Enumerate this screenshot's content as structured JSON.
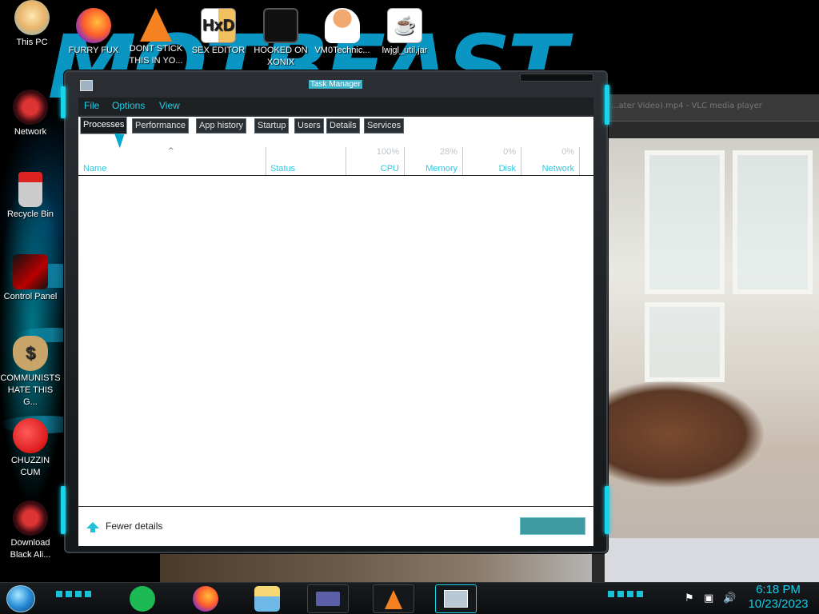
{
  "desktop": {
    "icons": [
      {
        "label": "This PC"
      },
      {
        "label": "FURRY FUX"
      },
      {
        "label": "DONT STICK\nTHIS IN YO..."
      },
      {
        "label": "SEX EDITOR"
      },
      {
        "label": "HOOKED ON\nXONIX"
      },
      {
        "label": "VM0Technic..."
      },
      {
        "label": "lwjgl_util.jar"
      },
      {
        "label": "Network"
      },
      {
        "label": "Recycle Bin"
      },
      {
        "label": "Control Panel"
      },
      {
        "label": "COMMUNISTS\nHATE THIS G..."
      },
      {
        "label": "CHUZZIN\nCUM"
      },
      {
        "label": "Download\nBlack Ali..."
      }
    ]
  },
  "vlc": {
    "title": "...ater Video).mp4 - VLC media player"
  },
  "task_manager": {
    "title": "Task Manager",
    "menu": [
      "File",
      "Options",
      "View"
    ],
    "tabs": [
      "Processes",
      "Performance",
      "App history",
      "Startup",
      "Users",
      "Details",
      "Services"
    ],
    "active_tab": "Processes",
    "columns": {
      "name": "Name",
      "status": "Status",
      "cpu": {
        "label": "CPU",
        "percent": "100%"
      },
      "memory": {
        "label": "Memory",
        "percent": "28%"
      },
      "disk": {
        "label": "Disk",
        "percent": "0%"
      },
      "network": {
        "label": "Network",
        "percent": "0%"
      }
    },
    "footer": {
      "fewer_details": "Fewer details"
    }
  },
  "taskbar": {
    "time": "6:18 PM",
    "date": "10/23/2023"
  },
  "colors": {
    "accent": "#18d4ea",
    "menu_text": "#21d0e6"
  }
}
